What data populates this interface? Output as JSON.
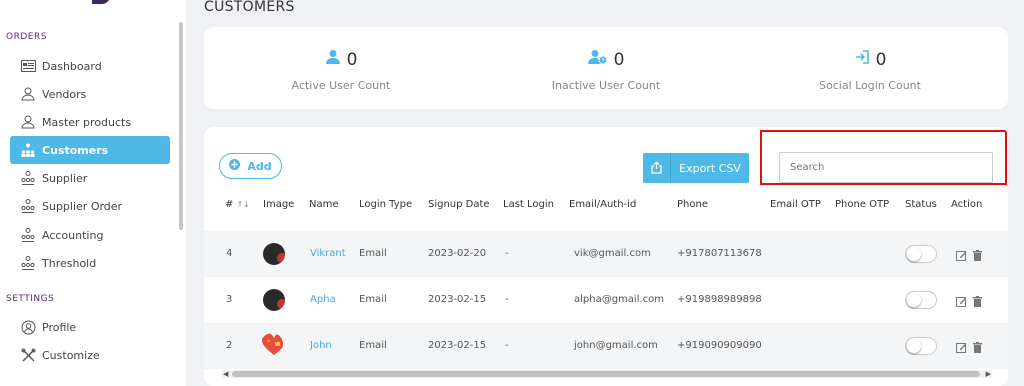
{
  "sidebar": {
    "orders_label": "ORDERS",
    "settings_label": "SETTINGS",
    "items": [
      {
        "label": "Dashboard",
        "icon": "dashboard-icon"
      },
      {
        "label": "Vendors",
        "icon": "user-tie-icon"
      },
      {
        "label": "Master products",
        "icon": "user-tie-icon"
      },
      {
        "label": "Customers",
        "icon": "org-chart-icon",
        "active": true
      },
      {
        "label": "Supplier",
        "icon": "org-chart-icon"
      },
      {
        "label": "Supplier Order",
        "icon": "org-chart-icon"
      },
      {
        "label": "Accounting",
        "icon": "org-chart-icon"
      },
      {
        "label": "Threshold",
        "icon": "org-chart-icon"
      }
    ],
    "settings_items": [
      {
        "label": "Profile",
        "icon": "profile-icon"
      },
      {
        "label": "Customize",
        "icon": "tools-icon"
      }
    ]
  },
  "page": {
    "title": "CUSTOMERS"
  },
  "stats": [
    {
      "value": "0",
      "label": "Active User Count",
      "icon": "user-icon"
    },
    {
      "value": "0",
      "label": "Inactive User Count",
      "icon": "user-clock-icon"
    },
    {
      "value": "0",
      "label": "Social Login Count",
      "icon": "sign-in-icon"
    }
  ],
  "toolbar": {
    "add_label": "Add",
    "export_label": "Export CSV",
    "search_placeholder": "Search"
  },
  "table": {
    "columns": [
      "#",
      "Image",
      "Name",
      "Login Type",
      "Signup Date",
      "Last Login",
      "Email/Auth-id",
      "Phone",
      "Email OTP",
      "Phone OTP",
      "Status",
      "Action"
    ],
    "rows": [
      {
        "id": "4",
        "name": "Vikrant",
        "login_type": "Email",
        "signup_date": "2023-02-20",
        "last_login": "-",
        "email": "vik@gmail.com",
        "phone": "+917807113678",
        "email_otp": "",
        "phone_otp": ""
      },
      {
        "id": "3",
        "name": "Apha",
        "login_type": "Email",
        "signup_date": "2023-02-15",
        "last_login": "-",
        "email": "alpha@gmail.com",
        "phone": "+919898989898",
        "email_otp": "",
        "phone_otp": ""
      },
      {
        "id": "2",
        "name": "John",
        "login_type": "Email",
        "signup_date": "2023-02-15",
        "last_login": "-",
        "email": "john@gmail.com",
        "phone": "+919090909090",
        "email_otp": "",
        "phone_otp": ""
      }
    ]
  },
  "colors": {
    "accent": "#4eb8e6",
    "highlight": "#e01010",
    "section": "#5a2a7a"
  }
}
